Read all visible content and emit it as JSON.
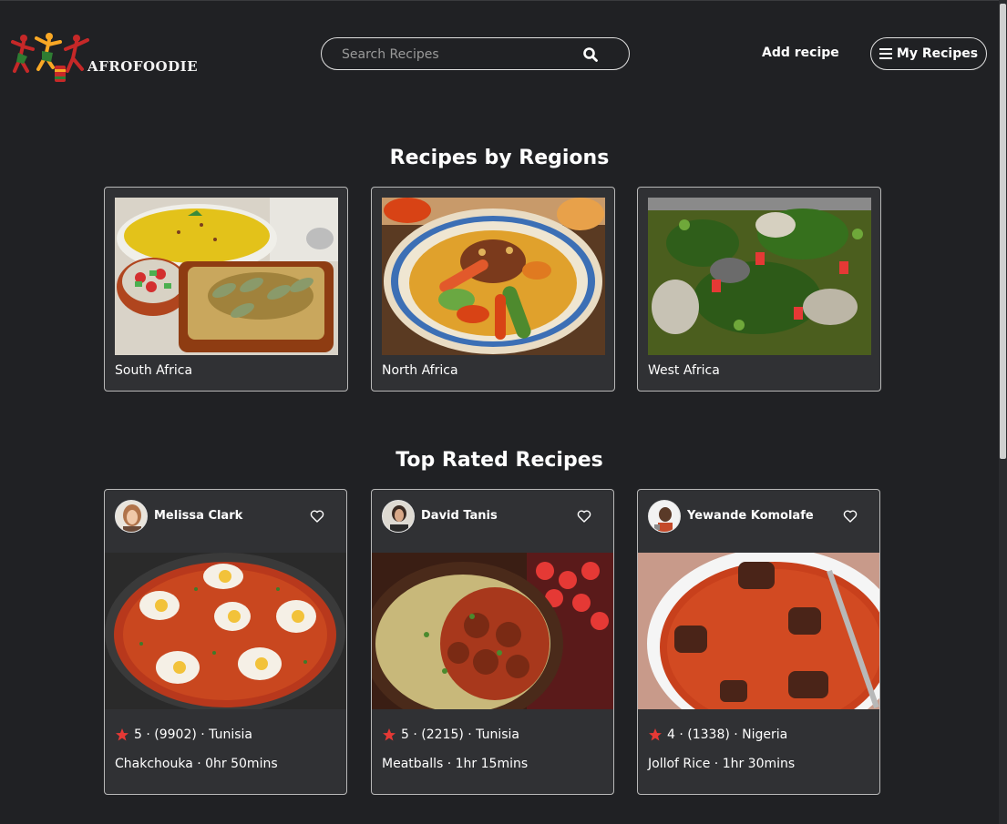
{
  "header": {
    "logo_text": "AFROFOODIE",
    "search_placeholder": "Search Recipes",
    "add_recipe_label": "Add recipe",
    "my_recipes_label": "My Recipes"
  },
  "regions_section": {
    "title": "Recipes by Regions",
    "items": [
      {
        "label": "South Africa"
      },
      {
        "label": "North Africa"
      },
      {
        "label": "West Africa"
      }
    ]
  },
  "top_rated_section": {
    "title": "Top Rated Recipes",
    "recipes": [
      {
        "author": "Melissa Clark",
        "meta": "5 · (9902) · Tunisia",
        "title": "Chakchouka · 0hr 50mins"
      },
      {
        "author": "David Tanis",
        "meta": "5 · (2215) · Tunisia",
        "title": "Meatballs · 1hr 15mins"
      },
      {
        "author": "Yewande Komolafe",
        "meta": "4 · (1338) · Nigeria",
        "title": "Jollof Rice · 1hr 30mins"
      }
    ]
  },
  "colors": {
    "background": "#202124",
    "card": "#303134",
    "star": "#e53935"
  }
}
